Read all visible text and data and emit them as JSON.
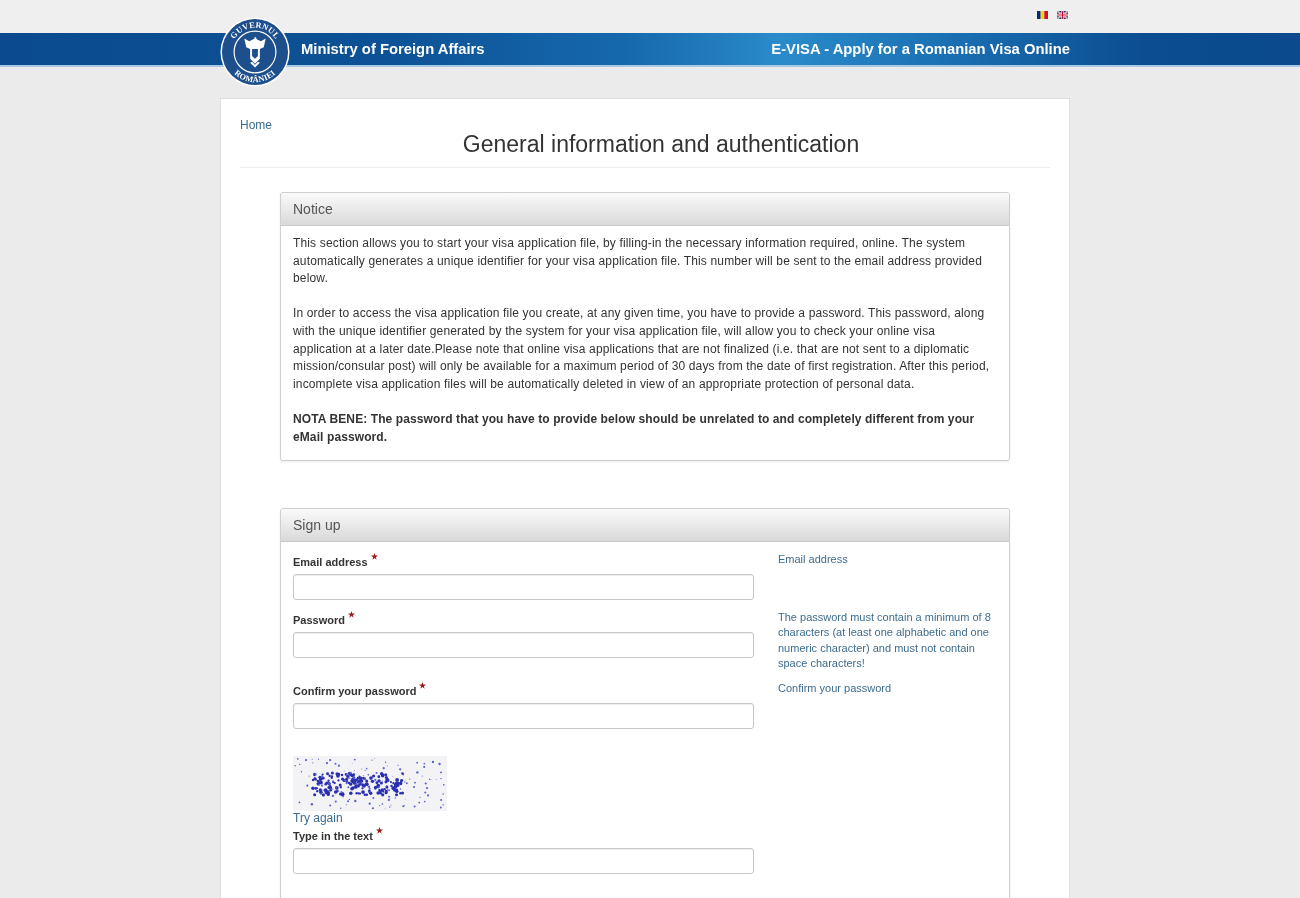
{
  "header": {
    "seal_top": "GUVERNUL",
    "seal_bottom": "ROMÂNIEI",
    "ministry": "Ministry of Foreign Affairs",
    "tagline": "E-VISA - Apply for a Romanian Visa Online"
  },
  "breadcrumb": "Home",
  "page_title": "General information and authentication",
  "notice": {
    "title": "Notice",
    "paragraphs": [
      "This section allows you to start your visa application file, by filling-in the necessary information required, online. The system automatically generates a unique identifier for your visa application file. This number will be sent to the email address provided below.",
      "In order to access the visa application file you create, at any given time, you have to provide a password. This password, along with the unique identifier generated by the system for your visa application file, will allow you to check your online visa application at a later date.Please note that online visa applications that are not finalized (i.e. that are not sent to a diplomatic mission/consular post) will only be available for a maximum period of 30 days from the date of first registration. After this period, incomplete visa application files will be automatically deleted in view of an appropriate protection of personal data."
    ],
    "nota_bene": "NOTA BENE: The password that you have to provide below should be unrelated to and completely different from your eMail password."
  },
  "signup": {
    "title": "Sign up",
    "fields": [
      {
        "label": "Email address",
        "required": true,
        "help": "Email address"
      },
      {
        "label": "Password",
        "required": true,
        "help": "The password must contain a minimum of 8 characters (at least one alphabetic and one numeric character) and must not contain space characters!"
      },
      {
        "label": "Confirm your password",
        "required": true,
        "help": "Confirm your password"
      }
    ],
    "captcha": {
      "link": "Try again",
      "label": "Type in the text",
      "required": true
    }
  }
}
